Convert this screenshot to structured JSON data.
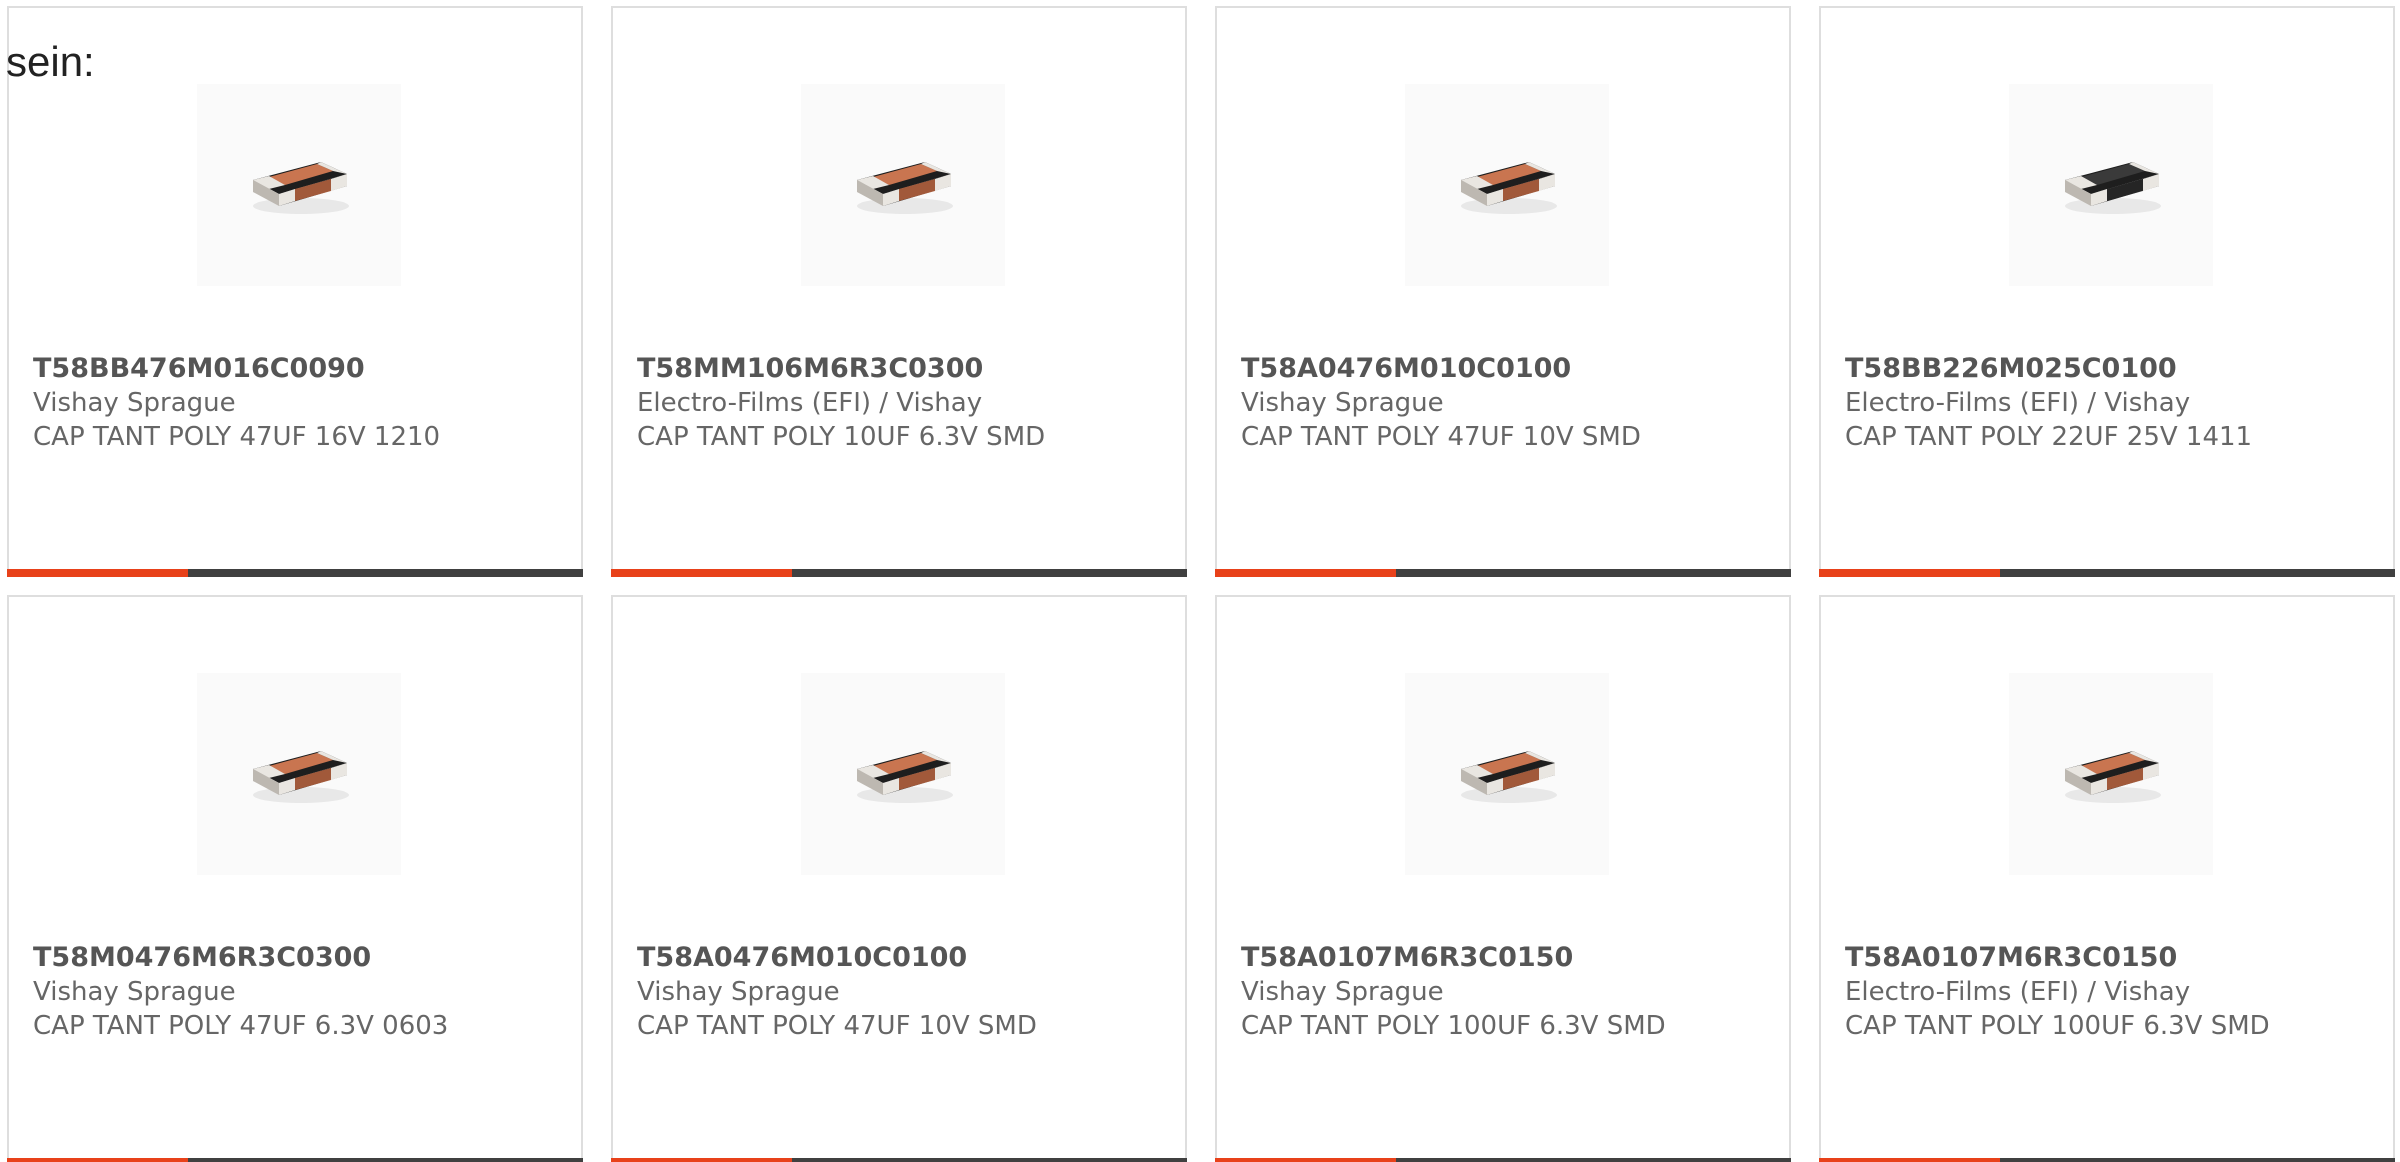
{
  "intro_text": "sein:",
  "colors": {
    "accent": "#e8411a",
    "bar_dark": "#404040",
    "card_border": "#dedede"
  },
  "products": [
    {
      "part": "T58BB476M016C0090",
      "maker": "Vishay Sprague",
      "desc": "CAP TANT POLY 47UF 16V 1210",
      "image_icon": "smd-capacitor-orange-icon",
      "bar_fraction": 0.315
    },
    {
      "part": "T58MM106M6R3C0300",
      "maker": "Electro-Films (EFI) / Vishay",
      "desc": "CAP TANT POLY 10UF 6.3V SMD",
      "image_icon": "smd-capacitor-orange-icon",
      "bar_fraction": 0.315
    },
    {
      "part": "T58A0476M010C0100",
      "maker": "Vishay Sprague",
      "desc": "CAP TANT POLY 47UF 10V SMD",
      "image_icon": "smd-capacitor-orange-icon",
      "bar_fraction": 0.315
    },
    {
      "part": "T58BB226M025C0100",
      "maker": "Electro-Films (EFI) / Vishay",
      "desc": "CAP TANT POLY 22UF 25V 1411",
      "image_icon": "smd-capacitor-black-icon",
      "bar_fraction": 0.315
    },
    {
      "part": "T58M0476M6R3C0300",
      "maker": "Vishay Sprague",
      "desc": "CAP TANT POLY 47UF 6.3V 0603",
      "image_icon": "smd-capacitor-orange-icon",
      "bar_fraction": 0.315
    },
    {
      "part": "T58A0476M010C0100",
      "maker": "Vishay Sprague",
      "desc": "CAP TANT POLY 47UF 10V SMD",
      "image_icon": "smd-capacitor-orange-icon",
      "bar_fraction": 0.315
    },
    {
      "part": "T58A0107M6R3C0150",
      "maker": "Vishay Sprague",
      "desc": "CAP TANT POLY 100UF 6.3V SMD",
      "image_icon": "smd-capacitor-orange-icon",
      "bar_fraction": 0.315
    },
    {
      "part": "T58A0107M6R3C0150",
      "maker": "Electro-Films (EFI) / Vishay",
      "desc": "CAP TANT POLY 100UF 6.3V SMD",
      "image_icon": "smd-capacitor-orange-icon",
      "bar_fraction": 0.315
    }
  ]
}
